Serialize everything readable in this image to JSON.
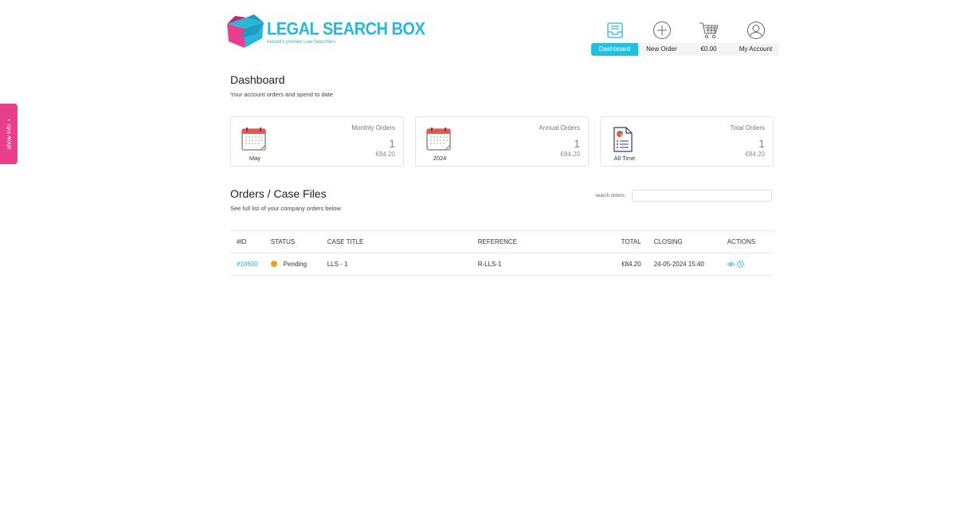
{
  "side_tab": {
    "label": "show info",
    "chevron": "›"
  },
  "logo": {
    "title": "LEGAL SEARCH BOX",
    "subtitle": "Ireland's premier Law Searchers",
    "colors": {
      "pink": "#e83e8c",
      "teal": "#29b6d8"
    }
  },
  "nav": {
    "items": [
      {
        "label": "Dashboard",
        "icon": "inbox-icon",
        "active": true
      },
      {
        "label": "New Order",
        "icon": "plus-circle-icon"
      },
      {
        "label": "€0.00",
        "icon": "cart-icon"
      },
      {
        "label": "My Account",
        "icon": "user-icon"
      }
    ]
  },
  "dashboard": {
    "title": "Dashboard",
    "subtitle": "Your account orders and spend to date",
    "cards": [
      {
        "title": "Monthly Orders",
        "count": "1",
        "amount": "€84.20",
        "caption": "May",
        "icon": "calendar-icon"
      },
      {
        "title": "Annual Orders",
        "count": "1",
        "amount": "€84.20",
        "caption": "2024",
        "icon": "calendar-icon"
      },
      {
        "title": "Total Orders",
        "count": "1",
        "amount": "€84.20",
        "caption": "All Time",
        "icon": "report-icon"
      }
    ]
  },
  "orders": {
    "title": "Orders / Case Files",
    "subtitle": "See full list of your company orders below",
    "search": {
      "label": "search orders:",
      "value": "",
      "placeholder": ""
    },
    "columns": [
      "#ID",
      "STATUS",
      "CASE TITLE",
      "REFERENCE",
      "TOTAL",
      "CLOSING",
      "ACTIONS"
    ],
    "rows": [
      {
        "id": "#10600",
        "status": "Pending",
        "status_color": "#f0a020",
        "case_title": "LLS - 1",
        "reference": "R-LLS-1",
        "total": "€84.20",
        "closing": "24-05-2024 15:40",
        "actions": [
          "eye-icon",
          "clock-icon"
        ]
      }
    ]
  },
  "colors": {
    "accent": "#22c0e0",
    "pending": "#f0a020",
    "side_tab": "#e83e8c"
  }
}
